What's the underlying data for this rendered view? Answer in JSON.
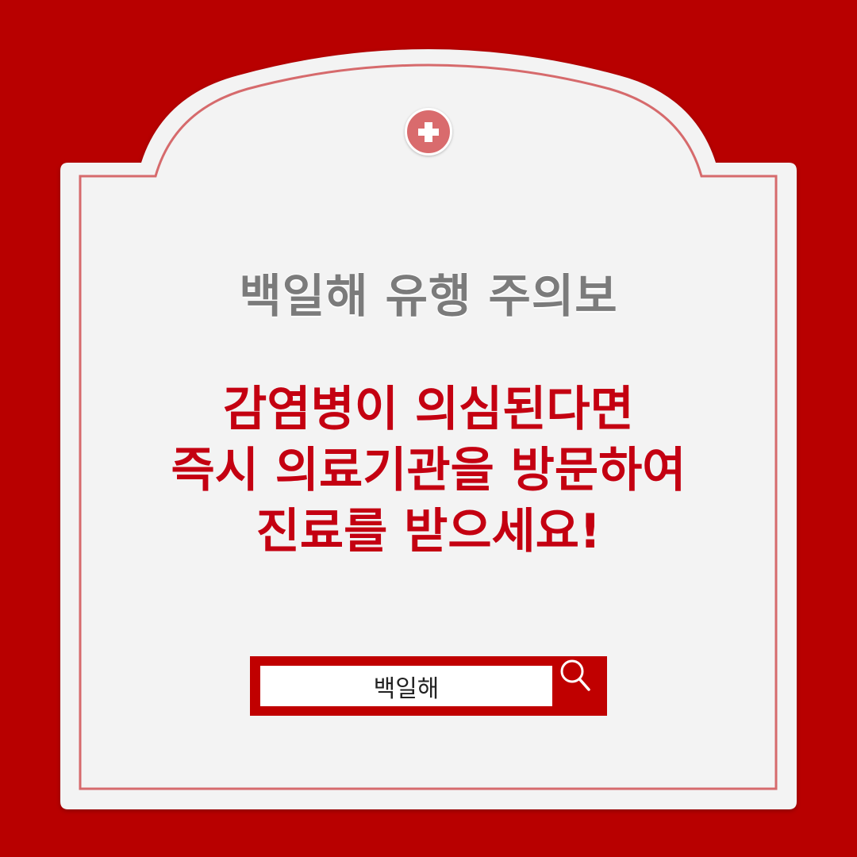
{
  "colors": {
    "background": "#b80000",
    "card": "#f3f3f3",
    "border_line": "#d66a6c",
    "title_text": "#7b7b7b",
    "message_text": "#c40011",
    "search_box": "#c00000"
  },
  "badge": {
    "icon": "medical-cross-icon"
  },
  "title": "백일해 유행 주의보",
  "message": {
    "lines": [
      "감염병이 의심된다면",
      "즉시 의료기관을 방문하여",
      "진료를 받으세요!"
    ]
  },
  "search": {
    "value": "백일해",
    "button_icon": "search-icon"
  }
}
